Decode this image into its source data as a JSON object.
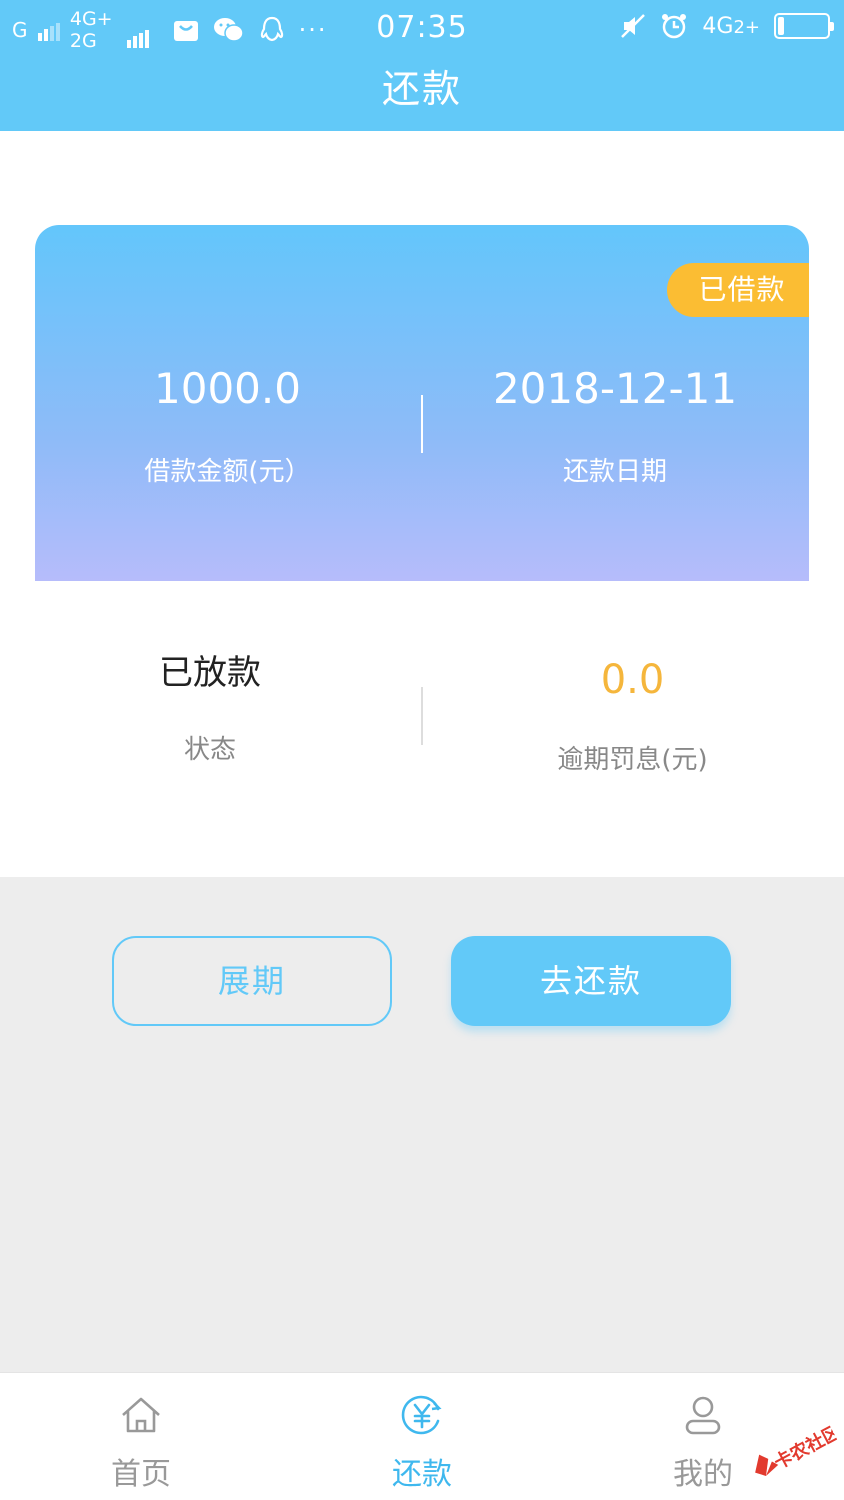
{
  "status_bar": {
    "net1": "G",
    "net2_top": "4G+",
    "net2_bottom": "2G",
    "time": "07:35",
    "net3": "4G",
    "net3_suffix": "2+"
  },
  "header": {
    "title": "还款"
  },
  "loan_card": {
    "badge": "已借款",
    "amount": "1000.0",
    "amount_label": "借款金额(元）",
    "date": "2018-12-11",
    "date_label": "还款日期"
  },
  "details": {
    "status_value": "已放款",
    "status_label": "状态",
    "penalty_value": "0.0",
    "penalty_label": "逾期罚息(元)"
  },
  "actions": {
    "extend_label": "展期",
    "repay_label": "去还款"
  },
  "tabbar": {
    "tabs": [
      {
        "label": "首页",
        "icon": "home-icon"
      },
      {
        "label": "还款",
        "icon": "yen-circle-icon"
      },
      {
        "label": "我的",
        "icon": "user-icon"
      }
    ],
    "active_index": 1
  },
  "watermark": {
    "text": "卡农社区"
  },
  "colors": {
    "primary": "#62c9f8",
    "badge": "#fbbd33",
    "penalty": "#f5b63c",
    "background": "#ededed"
  }
}
